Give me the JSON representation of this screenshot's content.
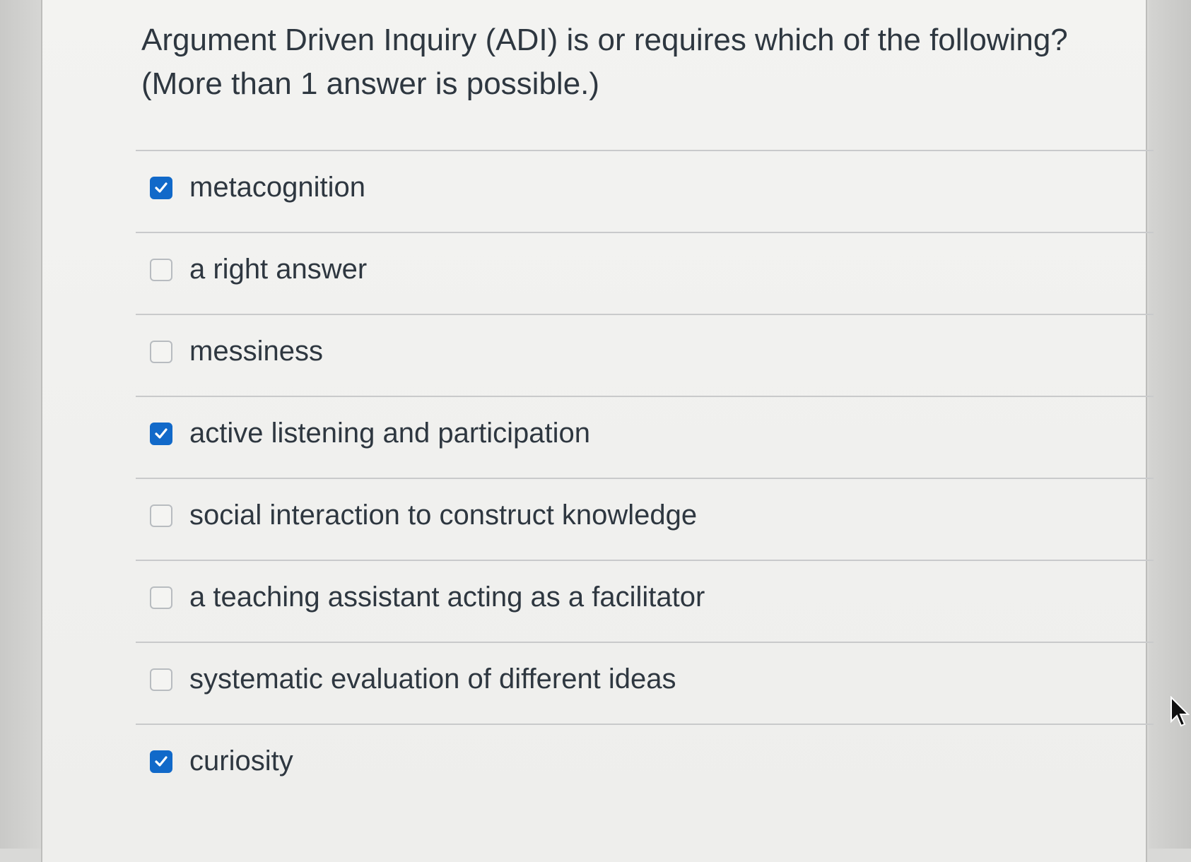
{
  "question": {
    "text": "Argument Driven Inquiry (ADI) is or requires which of the following? (More than 1 answer is possible.)"
  },
  "answers": [
    {
      "label": "metacognition",
      "checked": true
    },
    {
      "label": "a right answer",
      "checked": false
    },
    {
      "label": "messiness",
      "checked": false
    },
    {
      "label": "active listening and participation",
      "checked": true
    },
    {
      "label": "social interaction to construct knowledge",
      "checked": false
    },
    {
      "label": "a teaching assistant acting as a facilitator",
      "checked": false
    },
    {
      "label": "systematic evaluation of different ideas",
      "checked": false
    },
    {
      "label": "curiosity",
      "checked": true
    }
  ],
  "colors": {
    "accent": "#1169c9",
    "text": "#2e3740",
    "divider": "#c9cacb"
  },
  "icons": {
    "checked": "checkmark-icon",
    "cursor": "mouse-pointer-icon"
  }
}
